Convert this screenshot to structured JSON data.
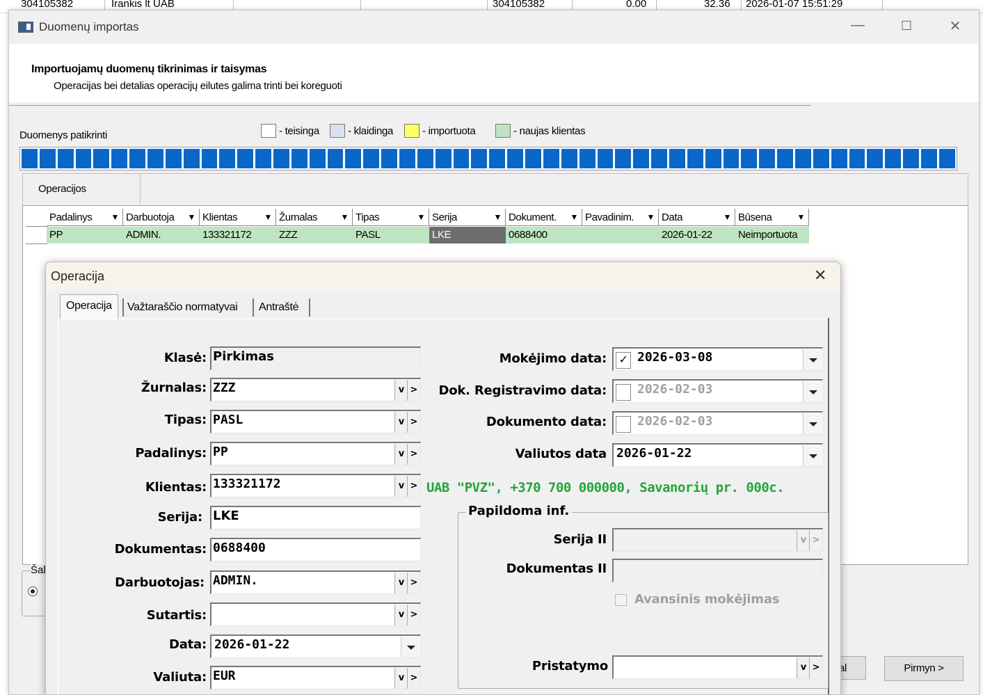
{
  "background_row": {
    "c1": "304105382",
    "c2": "Irankis lt UAB",
    "c3": "304105382",
    "c4": "0.00",
    "c5": "32.36",
    "c6": "2026-01-07 15:51:29"
  },
  "window": {
    "title": "Duomenų importas",
    "minimize": "—",
    "maximize": "☐",
    "close": "✕"
  },
  "header": {
    "title": "Importuojamų duomenų tikrinimas ir taisymas",
    "subtitle": "Operacijas bei detalias operacijų eilutes galima trinti bei koreguoti"
  },
  "status_label": "Duomenys patikrinti",
  "progress_fraction": 1.0,
  "legend": [
    {
      "label": "- teisinga",
      "color": "#ffffff"
    },
    {
      "label": "- klaidinga",
      "color": "#d9e1f0"
    },
    {
      "label": "- importuota",
      "color": "#ffff66"
    },
    {
      "label": "- naujas klientas",
      "color": "#bfe4c2"
    }
  ],
  "tab_operacijos": "Operacijos",
  "grid": {
    "columns": [
      "Padalinys",
      "Darbuotoja",
      "Klientas",
      "Žurnalas",
      "Tipas",
      "Serija",
      "Dokument.",
      "Pavadinim.",
      "Data",
      "Būsena"
    ],
    "filter_icon": "▼",
    "rows": [
      [
        "PP",
        "ADMIN.",
        "133321172",
        "ZZZ",
        "PASL",
        "LKE",
        "0688400",
        "",
        "2026-01-22",
        "Neimportuota"
      ]
    ]
  },
  "sal_label": "Šal",
  "buttons": {
    "cancel_partial": "al",
    "next": "Pirmyn >"
  },
  "dialog": {
    "title": "Operacija",
    "close": "✕",
    "tabs": [
      "Operacija",
      "Važtaraščio normatyvai",
      "Antraštė"
    ],
    "left": {
      "klase_label": "Klasė:",
      "klase_value": "Pirkimas",
      "zurnalas_label": "Žurnalas:",
      "zurnalas_value": "ZZZ",
      "tipas_label": "Tipas:",
      "tipas_value": "PASL",
      "padalinys_label": "Padalinys:",
      "padalinys_value": "PP",
      "klientas_label": "Klientas:",
      "klientas_value": "133321172",
      "serija_label": "Serija:",
      "serija_value": "LKE",
      "dokumentas_label": "Dokumentas:",
      "dokumentas_value": "0688400",
      "darbuotojas_label": "Darbuotojas:",
      "darbuotojas_value": "ADMIN.",
      "sutartis_label": "Sutartis:",
      "sutartis_value": "",
      "data_label": "Data:",
      "data_value": "2026-01-22",
      "valiuta_label": "Valiuta:",
      "valiuta_value": "EUR"
    },
    "client_info": "UAB \"PVZ\", +370 700 000000, Savanorių pr. 000c.",
    "right": {
      "mokejimo_label": "Mokėjimo data:",
      "mokejimo_value": "2026-03-08",
      "mokejimo_checked": true,
      "dokreg_label": "Dok. Registravimo data:",
      "dokreg_value": "2026-02-03",
      "dokreg_checked": false,
      "dokdata_label": "Dokumento data:",
      "dokdata_value": "2026-02-03",
      "dokdata_checked": false,
      "valiutos_label": "Valiutos data",
      "valiutos_value": "2026-01-22"
    },
    "papildoma": {
      "title": "Papildoma inf.",
      "serija2_label": "Serija II",
      "dokumentas2_label": "Dokumentas II",
      "avansinis_label": "Avansinis mokėjimas",
      "pristatymo_label": "Pristatymo"
    },
    "v_symbol": "v",
    "arrow_symbol": ">",
    "check_symbol": "✓"
  }
}
